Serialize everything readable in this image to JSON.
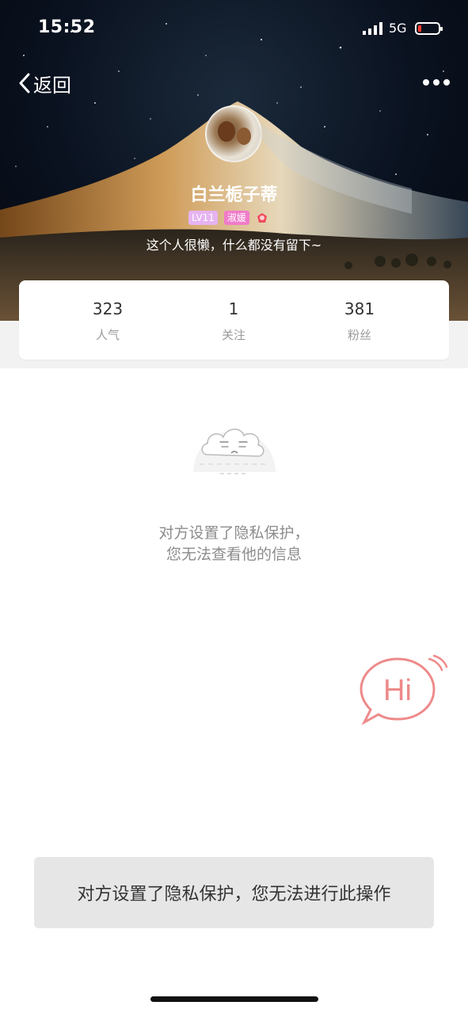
{
  "status_bar": {
    "time": "15:52",
    "network": "5G"
  },
  "nav": {
    "back_label": "返回"
  },
  "profile": {
    "username": "白兰栀子蒂",
    "level_badge": "LV11",
    "title_badge": "淑媛",
    "bio": "这个人很懒，什么都没有留下~"
  },
  "stats": [
    {
      "value": "323",
      "label": "人气"
    },
    {
      "value": "1",
      "label": "关注"
    },
    {
      "value": "381",
      "label": "粉丝"
    }
  ],
  "privacy": {
    "line1": "对方设置了隐私保护，",
    "line2": "您无法查看他的信息"
  },
  "hi_button": {
    "label": "Hi"
  },
  "toast": {
    "text": "对方设置了隐私保护，您无法进行此操作"
  },
  "colors": {
    "accent_pink": "#ee8a8a",
    "level_badge_bg": "#e6b3f2",
    "title_badge_bg": "#f07bc9",
    "battery_low": "#ff3b30"
  }
}
